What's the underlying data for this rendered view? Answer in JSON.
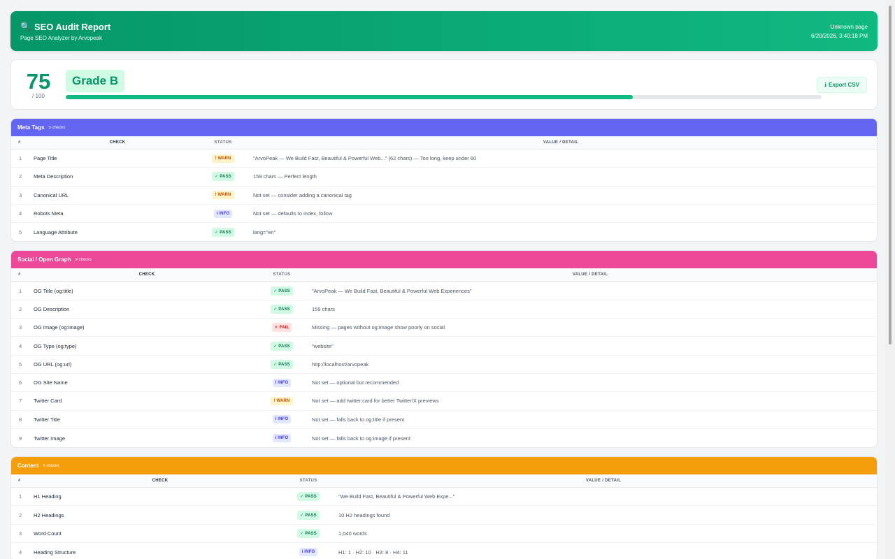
{
  "header": {
    "icon": "magnifier-icon",
    "title_icon": "🔍",
    "title": "SEO Audit Report",
    "subtitle": "Page SEO Analyzer by Arvopeak",
    "page": "Unknown page",
    "timestamp": "6/20/2026, 3:40:18 PM",
    "gradient": [
      "#059669",
      "#10b981"
    ]
  },
  "score": {
    "value": "75",
    "max": "/ 100",
    "grade": "Grade B",
    "progress_percent": 75,
    "export_icon": "ℹ",
    "export_label": "Export CSV"
  },
  "columns": {
    "num": "#",
    "check": "CHECK",
    "status": "STATUS",
    "value": "VALUE / DETAIL"
  },
  "badges": {
    "pass": "✓ PASS",
    "warn": "! WARN",
    "info": "i INFO",
    "fail": "✕ FAIL"
  },
  "colors": {
    "meta": "#6366f1",
    "social": "#ec4899",
    "content": "#f59e0b",
    "pass": "#047857",
    "warn": "#b45309",
    "info": "#4338ca",
    "fail": "#b91c1c"
  },
  "sections": [
    {
      "title": "Meta Tags",
      "count": "5 checks",
      "rows": [
        {
          "num": "1",
          "check": "Page Title",
          "status": "warn",
          "value": "\"ArvoPeak — We Build Fast, Beautiful & Powerful Web...\" (62 chars) — Too long, keep under 60"
        },
        {
          "num": "2",
          "check": "Meta Description",
          "status": "pass",
          "value": "159 chars — Perfect length"
        },
        {
          "num": "3",
          "check": "Canonical URL",
          "status": "warn",
          "value": "Not set — consider adding a canonical tag"
        },
        {
          "num": "4",
          "check": "Robots Meta",
          "status": "info",
          "value": "Not set — defaults to index, follow"
        },
        {
          "num": "5",
          "check": "Language Attribute",
          "status": "pass",
          "value": "lang=\"en\""
        }
      ]
    },
    {
      "title": "Social / Open Graph",
      "count": "9 checks",
      "rows": [
        {
          "num": "1",
          "check": "OG Title (og:title)",
          "status": "pass",
          "value": "\"ArvoPeak — We Build Fast, Beautiful & Powerful Web Experiences\""
        },
        {
          "num": "2",
          "check": "OG Description",
          "status": "pass",
          "value": "159 chars"
        },
        {
          "num": "3",
          "check": "OG Image (og:image)",
          "status": "fail",
          "value": "Missing — pages without og:image show poorly on social"
        },
        {
          "num": "4",
          "check": "OG Type (og:type)",
          "status": "pass",
          "value": "\"website\""
        },
        {
          "num": "5",
          "check": "OG URL (og:url)",
          "status": "pass",
          "value": "http://localhost/arvopeak"
        },
        {
          "num": "6",
          "check": "OG Site Name",
          "status": "info",
          "value": "Not set — optional but recommended"
        },
        {
          "num": "7",
          "check": "Twitter Card",
          "status": "warn",
          "value": "Not set — add twitter:card for better Twitter/X previews"
        },
        {
          "num": "8",
          "check": "Twitter Title",
          "status": "info",
          "value": "Not set — falls back to og:title if present"
        },
        {
          "num": "9",
          "check": "Twitter Image",
          "status": "info",
          "value": "Not set — falls back to og:image if present"
        }
      ]
    },
    {
      "title": "Content",
      "count": "4 checks",
      "rows": [
        {
          "num": "1",
          "check": "H1 Heading",
          "status": "pass",
          "value": "\"We Build Fast, Beautiful & Powerful Web Expe...\""
        },
        {
          "num": "2",
          "check": "H2 Headings",
          "status": "pass",
          "value": "10 H2 headings found"
        },
        {
          "num": "3",
          "check": "Word Count",
          "status": "pass",
          "value": "1,040 words"
        },
        {
          "num": "4",
          "check": "Heading Structure",
          "status": "info",
          "value": "H1: 1 · H2: 10 · H3: 8 · H4: 11"
        }
      ]
    }
  ]
}
